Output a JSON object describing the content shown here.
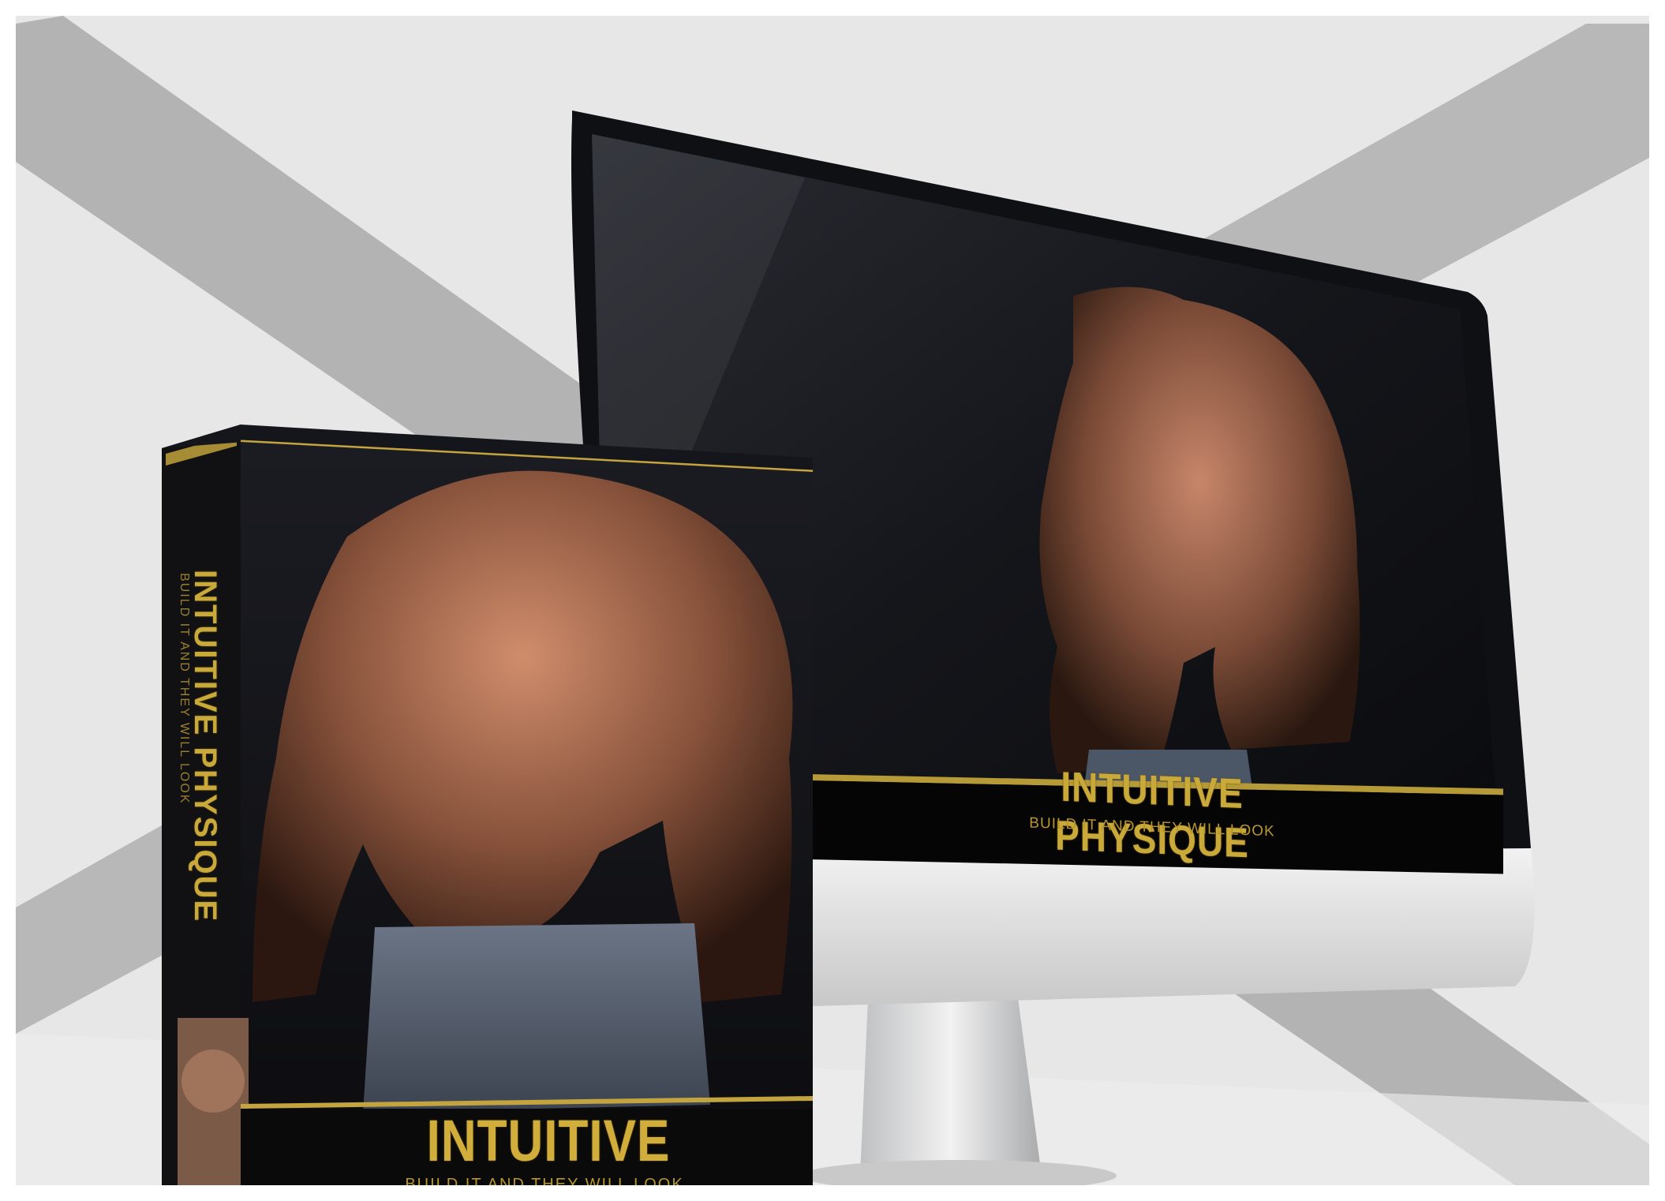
{
  "scene": {
    "background_color": "#e6e6e6",
    "band_color": "#b5b5b5",
    "accent_gold": "#c9a93a"
  },
  "monitor": {
    "title": "INTUITIVE PHYSIQUE",
    "subtitle": "BUILD IT AND THEY WILL LOOK",
    "bezel_color": "#111217",
    "body_color": "#dcdcdc"
  },
  "box": {
    "title": "INTUITIVE PHYSIQUE",
    "subtitle": "BUILD IT AND THEY WILL LOOK",
    "spine_title": "INTUITIVE PHYSIQUE",
    "spine_subtitle": "BUILD IT AND THEY WILL LOOK"
  },
  "icons": [
    "monitor-icon",
    "product-box-icon"
  ]
}
